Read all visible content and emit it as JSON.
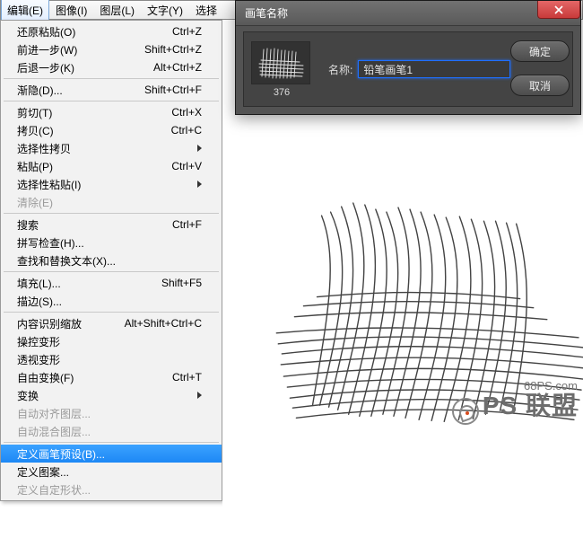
{
  "menubar": {
    "items": [
      {
        "label": "编辑(E)"
      },
      {
        "label": "图像(I)"
      },
      {
        "label": "图层(L)"
      },
      {
        "label": "文字(Y)"
      },
      {
        "label": "选择"
      }
    ]
  },
  "edit_menu": {
    "groups": [
      [
        {
          "label": "还原粘贴(O)",
          "shortcut": "Ctrl+Z",
          "enabled": true
        },
        {
          "label": "前进一步(W)",
          "shortcut": "Shift+Ctrl+Z",
          "enabled": true
        },
        {
          "label": "后退一步(K)",
          "shortcut": "Alt+Ctrl+Z",
          "enabled": true
        }
      ],
      [
        {
          "label": "渐隐(D)...",
          "shortcut": "Shift+Ctrl+F",
          "enabled": true
        }
      ],
      [
        {
          "label": "剪切(T)",
          "shortcut": "Ctrl+X",
          "enabled": true
        },
        {
          "label": "拷贝(C)",
          "shortcut": "Ctrl+C",
          "enabled": true
        },
        {
          "label": "选择性拷贝",
          "shortcut": "",
          "enabled": true,
          "submenu": true
        },
        {
          "label": "粘贴(P)",
          "shortcut": "Ctrl+V",
          "enabled": true
        },
        {
          "label": "选择性粘贴(I)",
          "shortcut": "",
          "enabled": true,
          "submenu": true
        },
        {
          "label": "清除(E)",
          "shortcut": "",
          "enabled": false
        }
      ],
      [
        {
          "label": "搜索",
          "shortcut": "Ctrl+F",
          "enabled": true
        },
        {
          "label": "拼写检查(H)...",
          "shortcut": "",
          "enabled": true
        },
        {
          "label": "查找和替换文本(X)...",
          "shortcut": "",
          "enabled": true
        }
      ],
      [
        {
          "label": "填充(L)...",
          "shortcut": "Shift+F5",
          "enabled": true
        },
        {
          "label": "描边(S)...",
          "shortcut": "",
          "enabled": true
        }
      ],
      [
        {
          "label": "内容识别缩放",
          "shortcut": "Alt+Shift+Ctrl+C",
          "enabled": true
        },
        {
          "label": "操控变形",
          "shortcut": "",
          "enabled": true
        },
        {
          "label": "透视变形",
          "shortcut": "",
          "enabled": true
        },
        {
          "label": "自由变换(F)",
          "shortcut": "Ctrl+T",
          "enabled": true
        },
        {
          "label": "变换",
          "shortcut": "",
          "enabled": true,
          "submenu": true
        },
        {
          "label": "自动对齐图层...",
          "shortcut": "",
          "enabled": false
        },
        {
          "label": "自动混合图层...",
          "shortcut": "",
          "enabled": false
        }
      ],
      [
        {
          "label": "定义画笔预设(B)...",
          "shortcut": "",
          "enabled": true,
          "highlight": true
        },
        {
          "label": "定义图案...",
          "shortcut": "",
          "enabled": true
        },
        {
          "label": "定义自定形状...",
          "shortcut": "",
          "enabled": false
        }
      ]
    ]
  },
  "dialog": {
    "title": "画笔名称",
    "thumb_label": "376",
    "name_label": "名称:",
    "name_value": "铅笔画笔1",
    "ok_label": "确定",
    "cancel_label": "取消"
  },
  "watermark": {
    "site": "68PS.com",
    "brand": "PS 联盟"
  }
}
